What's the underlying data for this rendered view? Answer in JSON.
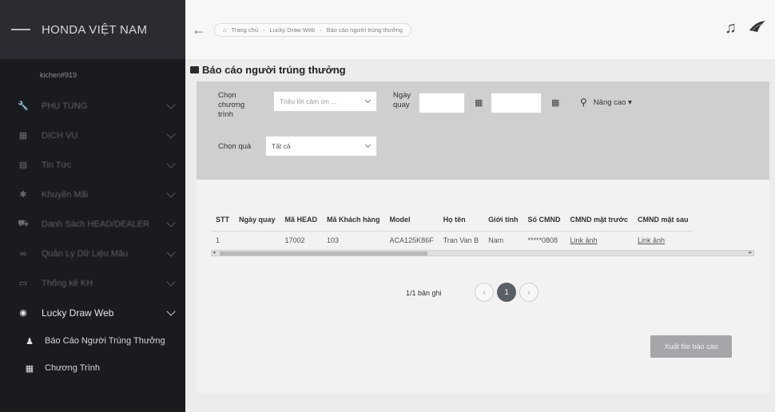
{
  "app": {
    "title": "HONDA VIỆT NAM",
    "username": "kichen#919"
  },
  "sidebar": {
    "items": [
      {
        "label": "PHỤ TÙNG",
        "icon": "wrench-icon"
      },
      {
        "label": "DỊCH VỤ",
        "icon": "building-icon"
      },
      {
        "label": "Tin Tức",
        "icon": "news-icon"
      },
      {
        "label": "Khuyến Mãi",
        "icon": "star-icon"
      },
      {
        "label": "Danh Sách HEAD/DEALER",
        "icon": "car-icon"
      },
      {
        "label": "Quản Lý Dữ Liệu Mẫu",
        "icon": "link-icon"
      },
      {
        "label": "Thống kê KH",
        "icon": "chart-icon"
      },
      {
        "label": "Lucky Draw Web",
        "icon": "user-circle-icon"
      }
    ],
    "subitems": [
      {
        "label": "Báo Cáo Người Trúng Thưởng",
        "icon": "user-icon"
      },
      {
        "label": "Chương Trình",
        "icon": "grid-icon"
      }
    ]
  },
  "header": {
    "breadcrumb": [
      "Trang chủ",
      "Lucky Draw Web",
      "Báo cáo người trúng thưởng"
    ]
  },
  "page": {
    "title": "Báo cáo người trúng thưởng"
  },
  "filter": {
    "program_label": "Chọn chương trình",
    "program_placeholder": "Triệu lời cảm ơn ...",
    "date_label": "Ngày quay",
    "gift_label": "Chọn quà",
    "gift_value": "Tất cả",
    "advanced_label": "Nâng cao ▾"
  },
  "table": {
    "columns": [
      "STT",
      "Ngày quay",
      "Mã HEAD",
      "Mã Khách hàng",
      "Model",
      "Họ tên",
      "Giới tính",
      "Số CMND",
      "CMND mặt trước",
      "CMND mặt sau"
    ],
    "rows": [
      [
        "1",
        "",
        "17002",
        "103",
        "ACA125K86F",
        "Tran Van B",
        "Nam",
        "*****0808",
        "Link ảnh",
        "Link ảnh"
      ]
    ]
  },
  "pagination": {
    "count_text": "1/1 bản ghi",
    "current": "1",
    "prev": "‹",
    "next": "›"
  },
  "actions": {
    "export_label": "Xuất file báo cáo"
  },
  "colors": {
    "sidebar_bg": "#1a1b1f",
    "filter_bg": "#cfcfd2",
    "page_btn": "#5b5f66",
    "export_bg": "#a4a6aa"
  }
}
